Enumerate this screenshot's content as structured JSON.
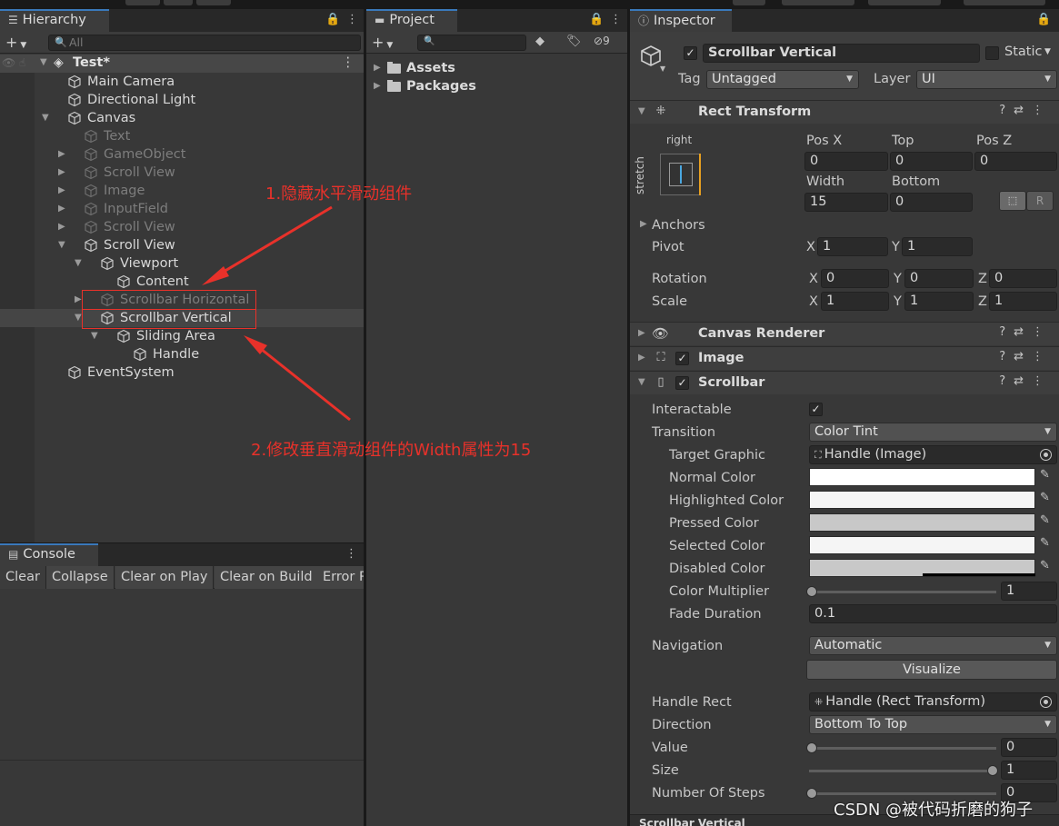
{
  "hierarchy": {
    "tab_label": "Hierarchy",
    "search_placeholder": "All",
    "scene_name": "Test*",
    "items": [
      {
        "label": "Main Camera",
        "depth": 0,
        "expander": "",
        "dim": false
      },
      {
        "label": "Directional Light",
        "depth": 0,
        "expander": "",
        "dim": false
      },
      {
        "label": "Canvas",
        "depth": 0,
        "expander": "open",
        "dim": false
      },
      {
        "label": "Text",
        "depth": 1,
        "expander": "",
        "dim": true
      },
      {
        "label": "GameObject",
        "depth": 1,
        "expander": "closed",
        "dim": true
      },
      {
        "label": "Scroll View",
        "depth": 1,
        "expander": "closed",
        "dim": true
      },
      {
        "label": "Image",
        "depth": 1,
        "expander": "closed",
        "dim": true
      },
      {
        "label": "InputField",
        "depth": 1,
        "expander": "closed",
        "dim": true
      },
      {
        "label": "Scroll View",
        "depth": 1,
        "expander": "closed",
        "dim": true
      },
      {
        "label": "Scroll View",
        "depth": 1,
        "expander": "open",
        "dim": false
      },
      {
        "label": "Viewport",
        "depth": 2,
        "expander": "open",
        "dim": false
      },
      {
        "label": "Content",
        "depth": 3,
        "expander": "",
        "dim": false
      },
      {
        "label": "Scrollbar Horizontal",
        "depth": 2,
        "expander": "closed",
        "dim": true
      },
      {
        "label": "Scrollbar Vertical",
        "depth": 2,
        "expander": "open",
        "dim": false,
        "selected": true
      },
      {
        "label": "Sliding Area",
        "depth": 3,
        "expander": "open",
        "dim": false
      },
      {
        "label": "Handle",
        "depth": 4,
        "expander": "",
        "dim": false
      },
      {
        "label": "EventSystem",
        "depth": 0,
        "expander": "",
        "dim": false
      }
    ]
  },
  "console": {
    "tab_label": "Console",
    "buttons": [
      "Clear",
      "Collapse",
      "Clear on Play",
      "Clear on Build",
      "Error P"
    ]
  },
  "project": {
    "tab_label": "Project",
    "hidden_count": "9",
    "folders": [
      "Assets",
      "Packages"
    ]
  },
  "inspector": {
    "tab_label": "Inspector",
    "object_name": "Scrollbar Vertical",
    "static_label": "Static",
    "tag_label": "Tag",
    "tag_value": "Untagged",
    "layer_label": "Layer",
    "layer_value": "UI",
    "rect_transform": {
      "title": "Rect Transform",
      "anchor_h": "right",
      "anchor_v": "stretch",
      "pos_x_label": "Pos X",
      "pos_x": "0",
      "top_label": "Top",
      "top": "0",
      "pos_z_label": "Pos Z",
      "pos_z": "0",
      "width_label": "Width",
      "width": "15",
      "bottom_label": "Bottom",
      "bottom": "0",
      "raw_btn": "R",
      "anchors_label": "Anchors",
      "pivot_label": "Pivot",
      "pivot_x": "1",
      "pivot_y": "1",
      "rotation_label": "Rotation",
      "rot_x": "0",
      "rot_y": "0",
      "rot_z": "0",
      "scale_label": "Scale",
      "scale_x": "1",
      "scale_y": "1",
      "scale_z": "1",
      "x": "X",
      "y": "Y",
      "z": "Z"
    },
    "canvas_renderer": "Canvas Renderer",
    "image": "Image",
    "scrollbar": {
      "title": "Scrollbar",
      "interactable_label": "Interactable",
      "transition_label": "Transition",
      "transition": "Color Tint",
      "target_graphic_label": "Target Graphic",
      "target_graphic": "Handle (Image)",
      "normal_color_label": "Normal Color",
      "normal_color": "#ffffff",
      "highlighted_color_label": "Highlighted Color",
      "highlighted_color": "#f5f5f5",
      "pressed_color_label": "Pressed Color",
      "pressed_color": "#c8c8c8",
      "selected_color_label": "Selected Color",
      "selected_color": "#f5f5f5",
      "disabled_color_label": "Disabled Color",
      "disabled_color": "#c8c8c8",
      "color_multiplier_label": "Color Multiplier",
      "color_multiplier": "1",
      "fade_duration_label": "Fade Duration",
      "fade_duration": "0.1",
      "navigation_label": "Navigation",
      "navigation": "Automatic",
      "visualize_btn": "Visualize",
      "handle_rect_label": "Handle Rect",
      "handle_rect": "Handle (Rect Transform)",
      "direction_label": "Direction",
      "direction": "Bottom To Top",
      "value_label": "Value",
      "value": "0",
      "size_label": "Size",
      "size": "1",
      "steps_label": "Number Of Steps",
      "steps": "0"
    },
    "bottom_label": "Scrollbar Vertical"
  },
  "annotations": {
    "note1": "1.隐藏水平滑动组件",
    "note2": "2.修改垂直滑动组件的Width属性为15",
    "color": "#e8312a"
  },
  "watermark": "CSDN @被代码折磨的狗子"
}
